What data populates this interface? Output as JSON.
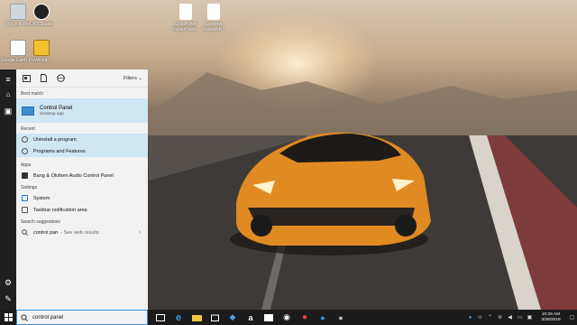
{
  "desktop_icons": [
    {
      "label": "Recycle Bin",
      "name": "recycle-bin"
    },
    {
      "label": "OBS Studio",
      "name": "obs-studio"
    },
    {
      "label": "Splash Adv PowerPoint...",
      "name": "file-1"
    },
    {
      "label": "Stevens Research 7",
      "name": "file-2"
    },
    {
      "label": "Google Earth Pro",
      "name": "google-earth"
    },
    {
      "label": "WinZip",
      "name": "winzip"
    }
  ],
  "search": {
    "tabs": [
      "all",
      "apps",
      "documents",
      "web"
    ],
    "filters_label": "Filters",
    "best_match_header": "Best match",
    "best_match": {
      "title": "Control Panel",
      "subtitle": "Desktop app"
    },
    "recent_header": "Recent",
    "recent": [
      "Uninstall a program",
      "Programs and Features"
    ],
    "apps_header": "Apps",
    "apps": [
      "Bang & Olufsen Audio Control Panel"
    ],
    "settings_header": "Settings",
    "settings": [
      "System",
      "Taskbar notification area"
    ],
    "suggestions_header": "Search suggestions",
    "suggestion": {
      "query": "control pan",
      "suffix": "- See web results"
    },
    "query": "control panel"
  },
  "taskbar": {
    "clock_time": "10:26 AM",
    "clock_date": "3/28/2019"
  },
  "colors": {
    "accent": "#0078d7",
    "highlight": "#cfe6f3",
    "taskbar": "#1b1b1b"
  }
}
